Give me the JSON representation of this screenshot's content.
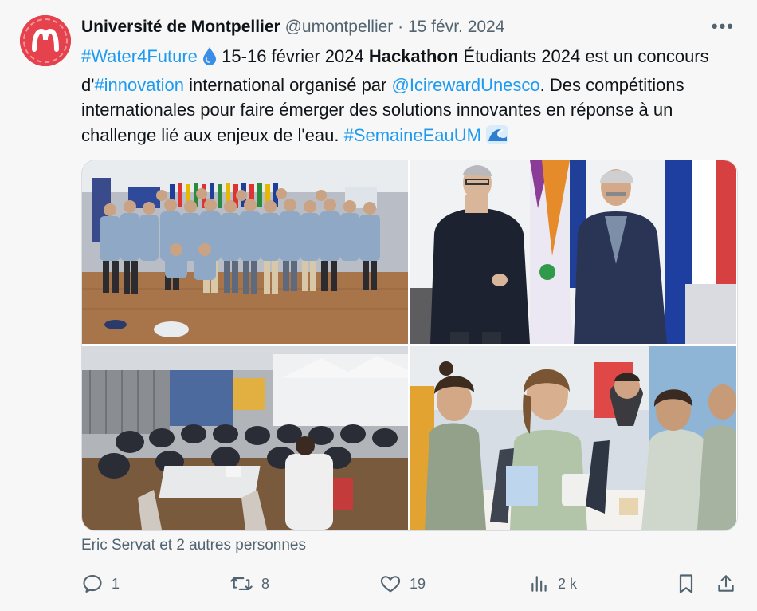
{
  "author": {
    "name": "Université de Montpellier",
    "handle": "@umontpellier",
    "separator": "·",
    "date": "15 févr. 2024",
    "avatar_icon": "um-logo-icon",
    "avatar_color": "#e5424d"
  },
  "more_icon": "more-icon",
  "tweet": {
    "hashtag_water": "#Water4Future",
    "droplet_icon": "droplet-icon",
    "dates": " 15-16 février 2024 ",
    "hackathon": "Hackathon",
    "part1": " Étudiants 2024 est un concours d'",
    "hashtag_innovation": "#innovation",
    "part2": " international organisé par ",
    "mention": "@IcirewardUnesco",
    "part3": ". Des compétitions internationales pour faire émerger des solutions innovantes en réponse à un challenge lié aux enjeux de l'eau. ",
    "hashtag_semaine": "#SemaineEauUM",
    "wave_icon": "wave-icon",
    "link_color": "#1d9bf0"
  },
  "photos": [
    {
      "name": "group-photo"
    },
    {
      "name": "two-men-photo"
    },
    {
      "name": "hall-photo"
    },
    {
      "name": "students-laptops-photo"
    }
  ],
  "tagged_people": "Eric Servat et 2 autres personnes",
  "actions": {
    "reply": {
      "icon": "reply-icon",
      "count": "1"
    },
    "retweet": {
      "icon": "retweet-icon",
      "count": "8"
    },
    "like": {
      "icon": "heart-icon",
      "count": "19"
    },
    "views": {
      "icon": "views-icon",
      "count": "2 k"
    },
    "bookmark": {
      "icon": "bookmark-icon"
    },
    "share": {
      "icon": "share-icon"
    }
  }
}
